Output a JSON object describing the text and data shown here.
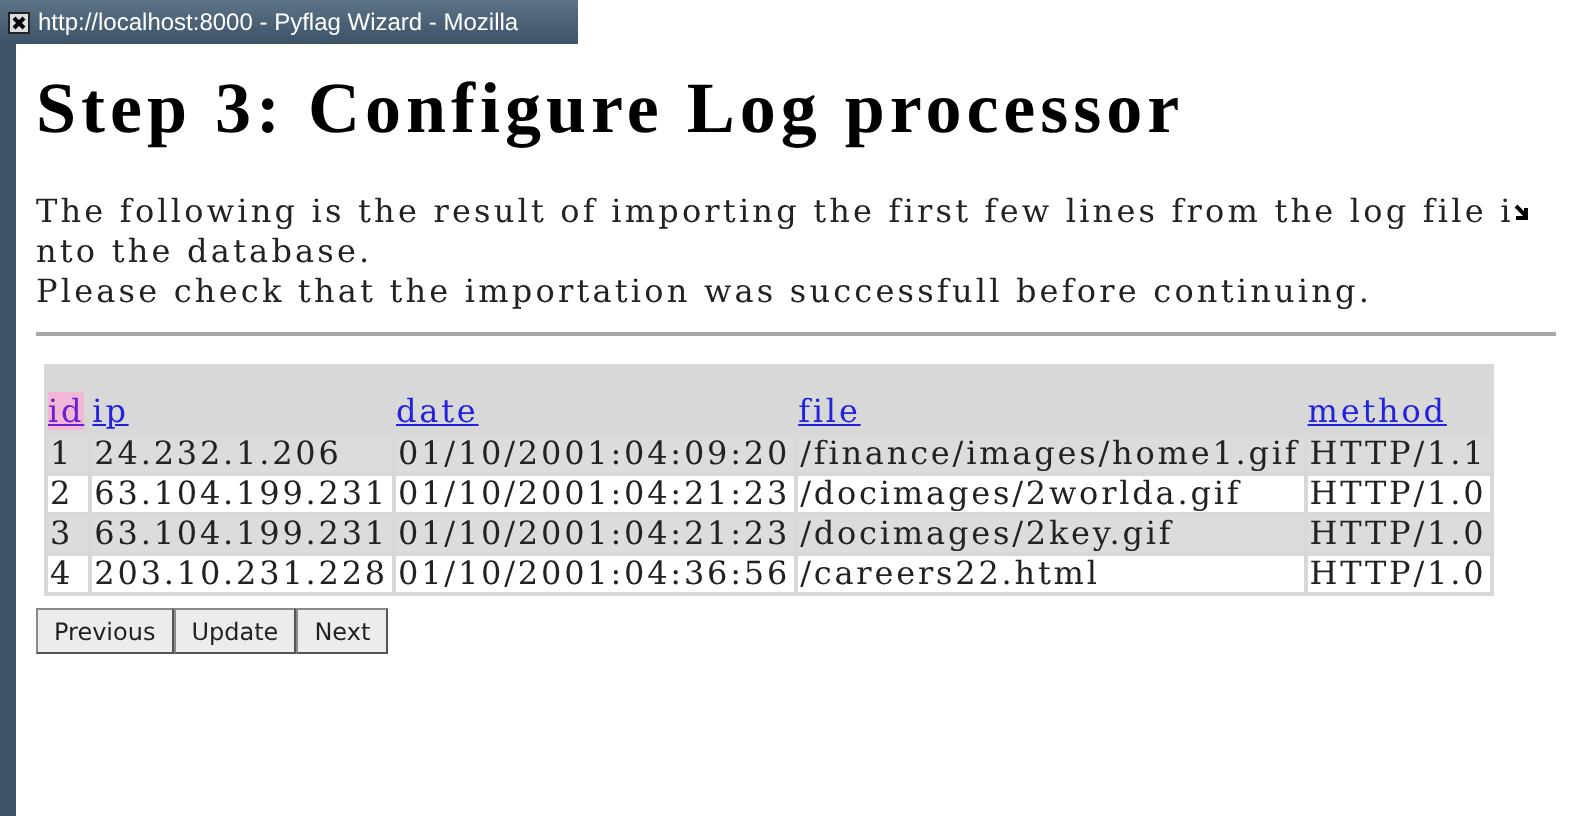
{
  "window": {
    "title": "http://localhost:8000 - Pyflag Wizard - Mozilla"
  },
  "heading": "Step 3: Configure Log processor",
  "intro_lines": [
    "The following is the result of importing the first few lines from the log file i",
    "nto the database.",
    "Please check that the importation was successfull before continuing."
  ],
  "table": {
    "columns": [
      {
        "label": "id",
        "selected": true
      },
      {
        "label": "ip",
        "selected": false
      },
      {
        "label": "date",
        "selected": false
      },
      {
        "label": "file",
        "selected": false
      },
      {
        "label": "method",
        "selected": false
      }
    ],
    "rows": [
      [
        "1",
        "24.232.1.206",
        "01/10/2001:04:09:20",
        "/finance/images/home1.gif",
        "HTTP/1.1"
      ],
      [
        "2",
        "63.104.199.231",
        "01/10/2001:04:21:23",
        "/docimages/2worlda.gif",
        "HTTP/1.0"
      ],
      [
        "3",
        "63.104.199.231",
        "01/10/2001:04:21:23",
        "/docimages/2key.gif",
        "HTTP/1.0"
      ],
      [
        "4",
        "203.10.231.228",
        "01/10/2001:04:36:56",
        "/careers22.html",
        "HTTP/1.0"
      ]
    ]
  },
  "buttons": [
    "Previous",
    "Update",
    "Next"
  ]
}
